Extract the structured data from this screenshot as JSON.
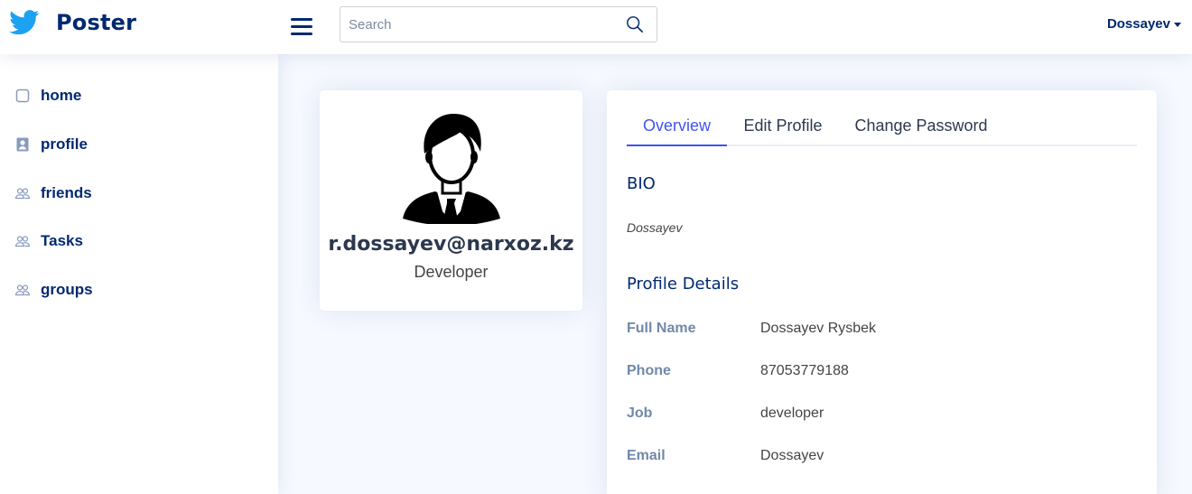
{
  "header": {
    "app_name": "Poster",
    "logo_icon": "twitter-bird-icon",
    "menu_icon": "hamburger-menu-icon",
    "search_placeholder": "Search",
    "search_value": "",
    "search_icon": "search-icon",
    "user_name": "Dossayev",
    "brand_color": "#012970",
    "logo_color": "#1da1f2"
  },
  "sidebar": {
    "items": [
      {
        "label": "home",
        "icon": "square-icon"
      },
      {
        "label": "profile",
        "icon": "person-badge-icon"
      },
      {
        "label": "friends",
        "icon": "people-icon"
      },
      {
        "label": "Tasks",
        "icon": "people-icon"
      },
      {
        "label": "groups",
        "icon": "people-icon"
      }
    ]
  },
  "profile_card": {
    "avatar_icon": "user-avatar-icon",
    "email": "r.dossayev@narxoz.kz",
    "job": "Developer"
  },
  "details": {
    "tabs": [
      {
        "label": "Overview",
        "active": true
      },
      {
        "label": "Edit Profile",
        "active": false
      },
      {
        "label": "Change Password",
        "active": false
      }
    ],
    "accent_color": "#4154f1",
    "bio_title": "BIO",
    "bio_text": "Dossayev",
    "profile_details_title": "Profile Details",
    "rows": [
      {
        "label": "Full Name",
        "value": "Dossayev Rysbek"
      },
      {
        "label": "Phone",
        "value": "87053779188"
      },
      {
        "label": "Job",
        "value": "developer"
      },
      {
        "label": "Email",
        "value": "Dossayev"
      }
    ]
  }
}
